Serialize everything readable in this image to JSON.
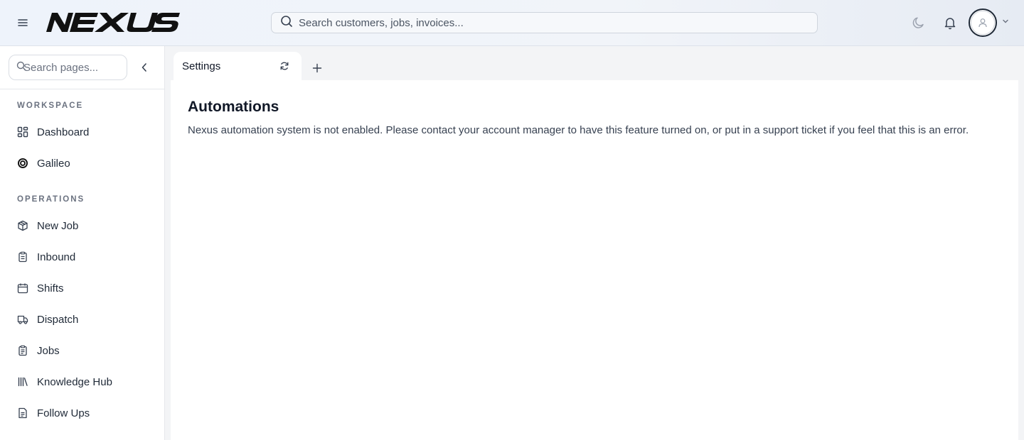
{
  "header": {
    "logo_text": "NEXUS",
    "search_placeholder": "Search customers, jobs, invoices..."
  },
  "sidebar": {
    "search_placeholder": "Search pages...",
    "sections": [
      {
        "label": "WORKSPACE"
      },
      {
        "label": "OPERATIONS"
      }
    ],
    "items": [
      {
        "label": "Dashboard",
        "icon": "dashboard-icon"
      },
      {
        "label": "Galileo",
        "icon": "galileo-icon"
      },
      {
        "label": "New Job",
        "icon": "package-icon"
      },
      {
        "label": "Inbound",
        "icon": "clipboard-icon"
      },
      {
        "label": "Shifts",
        "icon": "calendar-icon"
      },
      {
        "label": "Dispatch",
        "icon": "truck-icon"
      },
      {
        "label": "Jobs",
        "icon": "clipboard-list-icon"
      },
      {
        "label": "Knowledge Hub",
        "icon": "library-icon"
      },
      {
        "label": "Follow Ups",
        "icon": "file-text-icon"
      }
    ]
  },
  "tabs": [
    {
      "label": "Settings"
    }
  ],
  "main": {
    "title": "Automations",
    "message": "Nexus automation system is not enabled. Please contact your account manager to have this feature turned on, or put in a support ticket if you feel that this is an error."
  }
}
